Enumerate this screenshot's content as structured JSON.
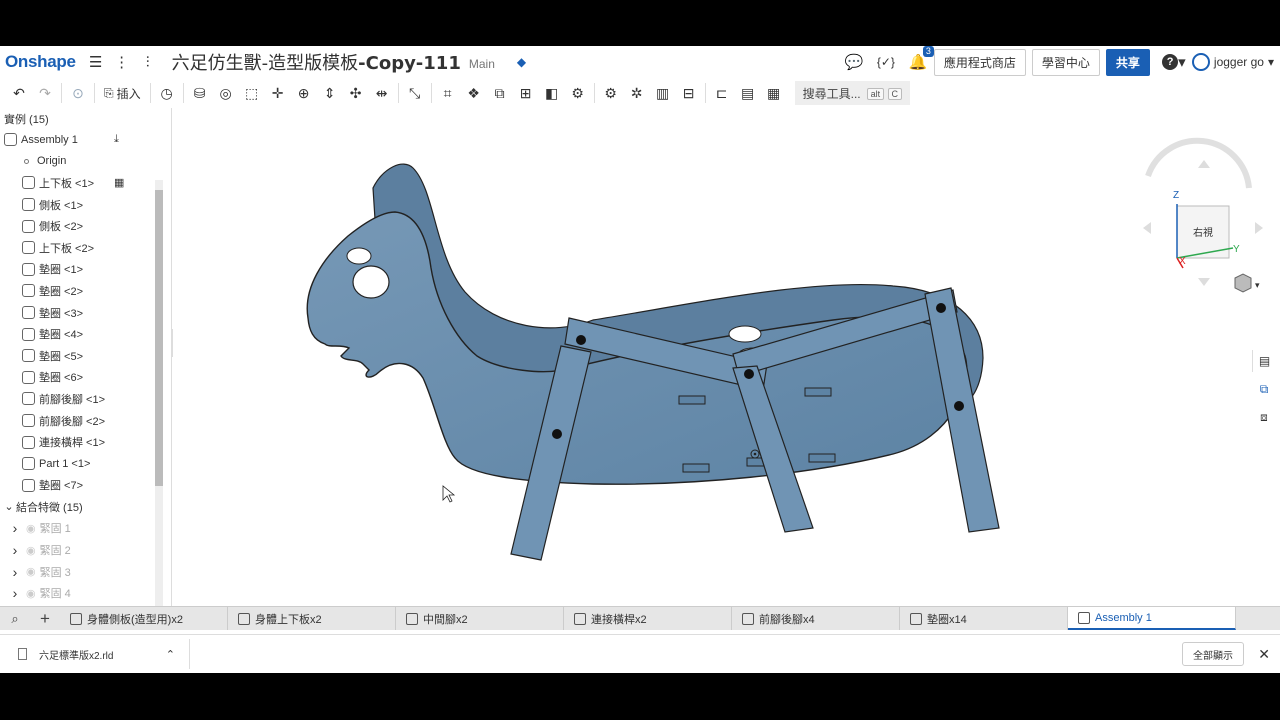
{
  "header": {
    "logo": "Onshape",
    "doc_title_prefix": "六足仿生獸-造型版模板",
    "doc_title_bold": "-Copy-111",
    "branch": "Main",
    "notifications_count": "3",
    "app_store": "應用程式商店",
    "learning": "學習中心",
    "share": "共享",
    "help": "?",
    "user": "jogger go"
  },
  "toolbar": {
    "insert": "插入",
    "search_label": "搜尋工具...",
    "shortcut_key1": "alt",
    "shortcut_key2": "C"
  },
  "instances": {
    "header": "實例 (15)",
    "assembly": "Assembly 1",
    "origin": "Origin",
    "items": [
      "上下板 <1>",
      "側板 <1>",
      "側板 <2>",
      "上下板 <2>",
      "墊圈 <1>",
      "墊圈 <2>",
      "墊圈 <3>",
      "墊圈 <4>",
      "墊圈 <5>",
      "墊圈 <6>",
      "前腳後腳 <1>",
      "前腳後腳 <2>",
      "連接橫桿 <1>",
      "Part 1 <1>",
      "墊圈 <7>"
    ]
  },
  "mates": {
    "header": "結合特徵 (15)",
    "items": [
      "緊固 1",
      "緊固 2",
      "緊固 3",
      "緊固 4"
    ]
  },
  "viewcube": {
    "face_label": "右視",
    "axis_z": "Z",
    "axis_y": "Y",
    "axis_x": "X"
  },
  "tabs": [
    "身體側板(造型用)x2",
    "身體上下板x2",
    "中間腳x2",
    "連接橫桿x2",
    "前腳後腳x4",
    "墊圈x14",
    "Assembly 1"
  ],
  "download": {
    "file": "六足標準版x2.rld",
    "show_all": "全部顯示"
  },
  "colors": {
    "brand": "#1a5fb4",
    "part": "#6b8fae"
  }
}
